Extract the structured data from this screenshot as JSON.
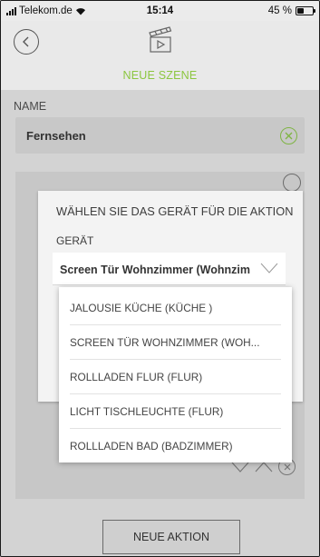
{
  "status_bar": {
    "carrier": "Telekom.de",
    "time": "15:14",
    "battery": "45 %",
    "battery_level": 0.45,
    "icons": [
      "signal-icon",
      "wifi-icon",
      "battery-icon"
    ]
  },
  "header": {
    "title": "NEUE SZENE",
    "icons": [
      "back-icon",
      "scene-clapperboard-icon"
    ]
  },
  "form": {
    "name_label": "NAME",
    "name_value": "Fernsehen"
  },
  "dialog": {
    "title": "WÄHLEN SIE DAS GERÄT FÜR DIE AKTION",
    "device_label": "GERÄT",
    "selected_device": "Screen Tür Wohnzimmer  (Wohnzimmer)"
  },
  "dropdown": {
    "options": [
      "JALOUSIE KÜCHE (KÜCHE )",
      "SCREEN TÜR WOHNZIMMER (WOH...",
      "ROLLLADEN FLUR (FLUR)",
      "LICHT TISCHLEUCHTE (FLUR)",
      "ROLLLADEN BAD (BADZIMMER)"
    ]
  },
  "footer": {
    "new_action_label": "NEUE AKTION"
  },
  "colors": {
    "accent_green": "#8cc63f",
    "overlay_gray": "#d3d3d3",
    "dialog_bg": "#f3f3f3"
  }
}
